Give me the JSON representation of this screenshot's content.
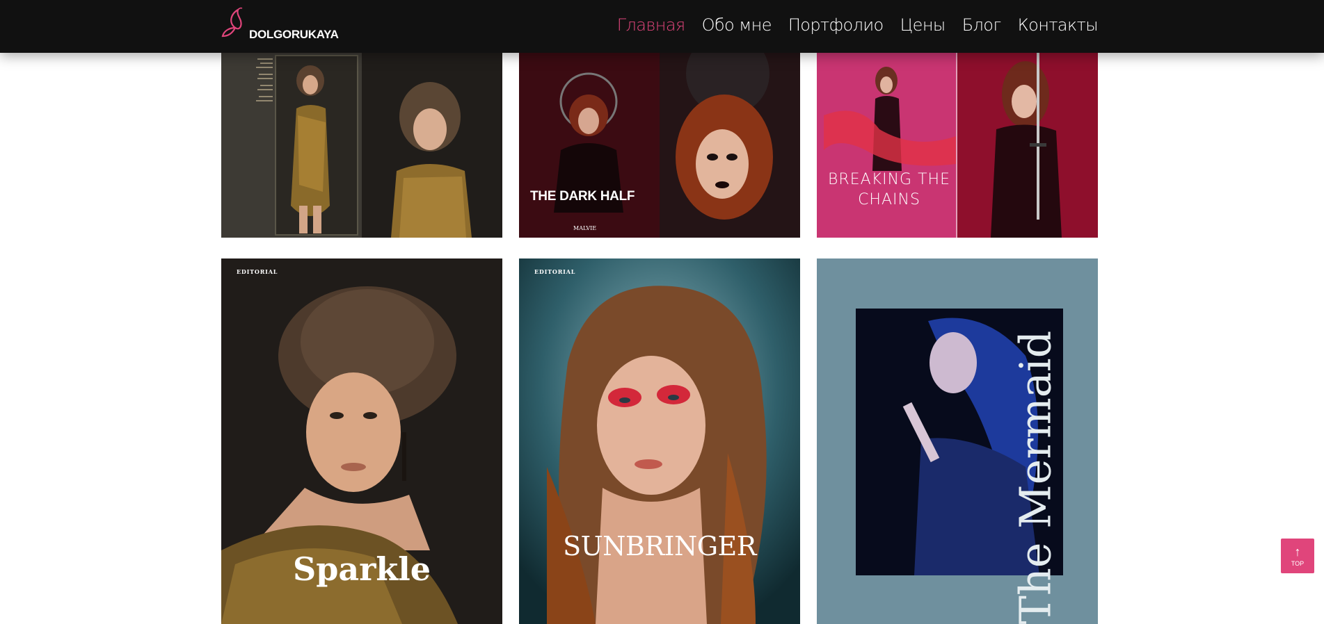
{
  "brand": {
    "name": "DOLGORUKAYA",
    "accent": "#e0457b"
  },
  "nav": {
    "items": [
      {
        "label": "Главная",
        "active": true
      },
      {
        "label": "Обо мне"
      },
      {
        "label": "Портфолио"
      },
      {
        "label": "Цены"
      },
      {
        "label": "Блог"
      },
      {
        "label": "Контакты"
      }
    ]
  },
  "gallery": {
    "covers": [
      {
        "title": "",
        "kicker": ""
      },
      {
        "title": "THE DARK HALF",
        "kicker": "MALVIE"
      },
      {
        "title": "BREAKING THE CHAINS",
        "kicker": ""
      },
      {
        "title": "Sparkle",
        "kicker": "EDITORIAL"
      },
      {
        "title": "SUNBRINGER",
        "kicker": "EDITORIAL"
      },
      {
        "title": "The Mermaid",
        "kicker": ""
      }
    ]
  },
  "scroll_top": {
    "label": "TOP",
    "icon": "arrow-up-icon"
  }
}
